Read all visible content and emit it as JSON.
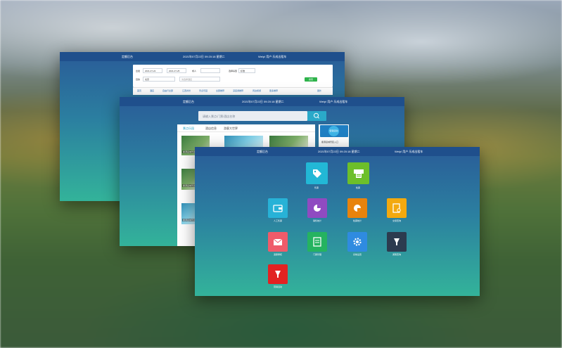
{
  "colors": {
    "topbar": "#1f4f8c",
    "gradient_top": "#2a5c98",
    "gradient_bottom": "#33b39a",
    "accent_green": "#2eb34b",
    "accent_cyan": "#2aa9c9"
  },
  "window1": {
    "title": "定额后台",
    "datetime": "2021年07月22日 09:20:18 星期二",
    "user": "Welp! 用户 乐成出租车",
    "form": {
      "from_label": "出发",
      "from_date": "2021-07-22",
      "to_date": "2021-07-25",
      "adults_label": "成人",
      "room_label": "选择房型",
      "room_value": "标准",
      "dest_label": "目的",
      "dest_value": "北京",
      "hotel_placeholder": "请选择酒店",
      "search_label": "搜索"
    },
    "tabs": [
      "首页",
      "酒店",
      "自由行全部",
      "江西省份",
      "景点乐园",
      "全部推荐",
      "深度游推荐",
      "周边旅游",
      "更多推荐",
      "国外"
    ]
  },
  "window2": {
    "title": "定额后台",
    "datetime": "2021年07月22日 09:20:18 星期二",
    "user": "Welp! 用户 乐成出租车",
    "search_placeholder": "请输入景点/门票/酒店名称",
    "tabs": [
      "景点乐园",
      "酒店信息",
      "游客大世界"
    ],
    "active_tab": "景点乐园",
    "captions": [
      "婺源县城景区",
      "婺源县城景区",
      "婺源县城景区"
    ],
    "badge_text": "促销活动",
    "side_label": "婺源县城景区入口"
  },
  "window3": {
    "title": "定额后台",
    "datetime": "2021年07月22日 09:20:18 星期二",
    "user": "Welp! 用户 乐成出租车",
    "top_apps": [
      {
        "label": "售票",
        "icon": "tag-icon",
        "color": "#22b8d6"
      },
      {
        "label": "检票",
        "icon": "ticket-machine-icon",
        "color": "#6dbf2a"
      }
    ],
    "apps": [
      {
        "label": "人工售票",
        "icon": "wallet-icon",
        "color": "#27b2d7"
      },
      {
        "label": "销售统计",
        "icon": "pie-chart-icon",
        "color": "#8f4bc1"
      },
      {
        "label": "检票统计",
        "icon": "pie-chart-orange-icon",
        "color": "#e8830d"
      },
      {
        "label": "交易查询",
        "icon": "document-search-icon",
        "color": "#f3a90f"
      },
      {
        "label": "退票审核",
        "icon": "mail-icon",
        "color": "#ef5b6a"
      },
      {
        "label": "门票管理",
        "icon": "form-icon",
        "color": "#25b360"
      },
      {
        "label": "系统设置",
        "icon": "gear-icon",
        "color": "#2f8be0"
      },
      {
        "label": "游客查询",
        "icon": "cup-icon",
        "color": "#2c3b4f"
      },
      {
        "label": "营销活动",
        "icon": "cup-red-icon",
        "color": "#e22222"
      }
    ]
  }
}
